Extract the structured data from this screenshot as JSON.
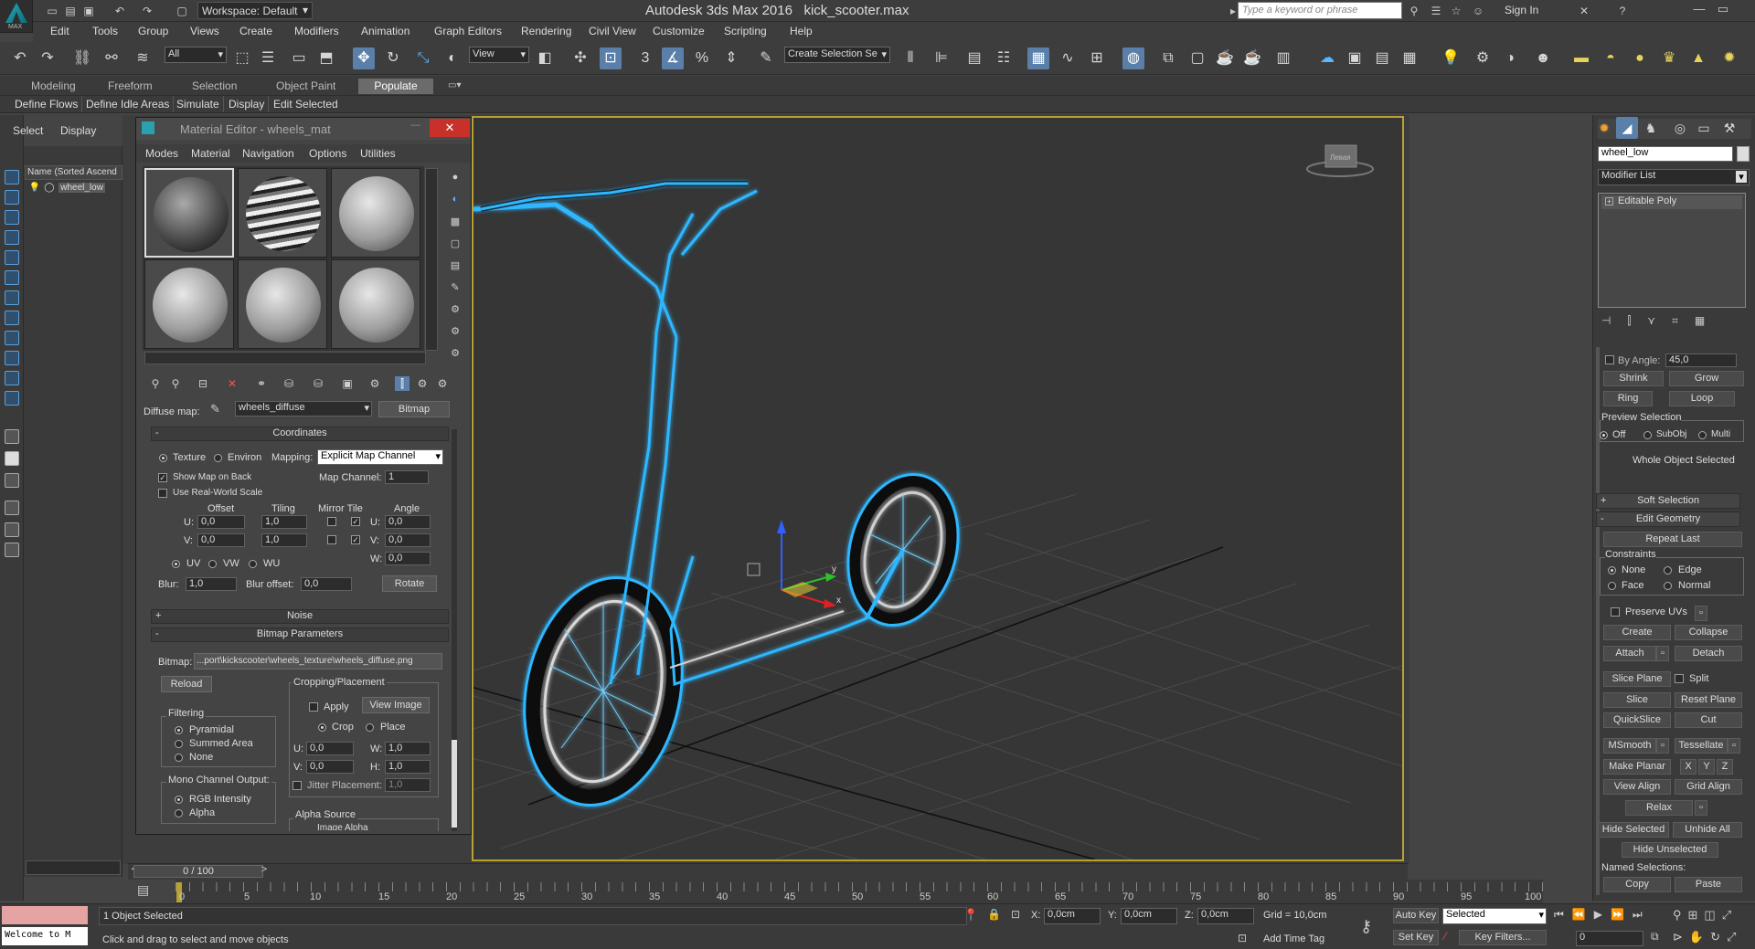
{
  "app": {
    "title": "Autodesk 3ds Max 2016",
    "file": "kick_scooter.max",
    "logo_text": "MAX",
    "workspace": "Workspace: Default",
    "search_placeholder": "Type a keyword or phrase",
    "sign_in": "Sign In"
  },
  "menu": [
    "Edit",
    "Tools",
    "Group",
    "Views",
    "Create",
    "Modifiers",
    "Animation",
    "Graph Editors",
    "Rendering",
    "Civil View",
    "Customize",
    "Scripting",
    "Help"
  ],
  "toolbar": {
    "selection_filter": "All",
    "ref_coord": "View",
    "named_selection": "Create Selection Se",
    "icons": [
      "undo-icon",
      "redo-icon",
      "link-icon",
      "unlink-icon",
      "bind-spacewarp-icon",
      "select-object-icon",
      "select-by-name-icon",
      "rect-region-icon",
      "window-crossing-icon",
      "select-move-icon",
      "select-rotate-icon",
      "select-scale-icon",
      "select-place-icon",
      "pivot-icon",
      "select-manipulate-icon",
      "snap-3-icon",
      "angle-snap-icon",
      "percent-snap-icon",
      "spinner-snap-icon",
      "edit-named-sel-icon",
      "mirror-icon",
      "align-icon",
      "layer-icon",
      "scene-explorer-icon",
      "graphite-icon",
      "curve-editor-icon",
      "schematic-icon",
      "material-editor-icon",
      "render-setup-icon",
      "rendered-frame-icon",
      "render-icon",
      "render-iterative-icon"
    ]
  },
  "ribbon": {
    "tabs": [
      "Modeling",
      "Freeform",
      "Selection",
      "Object Paint",
      "Populate"
    ],
    "active_tab": "Populate",
    "panels": [
      "Define Flows",
      "Define Idle Areas",
      "Simulate",
      "Display",
      "Edit Selected"
    ]
  },
  "scene_explorer": {
    "tabs": [
      "Select",
      "Display"
    ],
    "column": "Name (Sorted Ascend",
    "item": "wheel_low"
  },
  "material_editor": {
    "title": "Material Editor - wheels_mat",
    "menu": [
      "Modes",
      "Material",
      "Navigation",
      "Options",
      "Utilities"
    ],
    "diffuse_label": "Diffuse map:",
    "diffuse_map": "wheels_diffuse",
    "map_type": "Bitmap",
    "coordinates": {
      "header": "Coordinates",
      "texture": "Texture",
      "environ": "Environ",
      "mapping_label": "Mapping:",
      "mapping": "Explicit Map Channel",
      "show_map_on_back": "Show Map on Back",
      "map_channel_label": "Map Channel:",
      "map_channel": "1",
      "use_real_world": "Use Real-World Scale",
      "offset": "Offset",
      "tiling": "Tiling",
      "mirror_tile": "Mirror Tile",
      "angle": "Angle",
      "u_label": "U:",
      "v_label": "V:",
      "w_label": "W:",
      "u_offset": "0,0",
      "v_offset": "0,0",
      "u_tiling": "1,0",
      "v_tiling": "1,0",
      "u_angle": "0,0",
      "v_angle": "0,0",
      "w_angle": "0,0",
      "uv": "UV",
      "vw": "VW",
      "wu": "WU",
      "blur_label": "Blur:",
      "blur": "1,0",
      "blur_offset_label": "Blur offset:",
      "blur_offset": "0,0",
      "rotate": "Rotate"
    },
    "noise_header": "Noise",
    "bitmap": {
      "header": "Bitmap Parameters",
      "label": "Bitmap:",
      "path": "...port\\kickscooter\\wheels_texture\\wheels_diffuse.png",
      "reload": "Reload",
      "cropping": "Cropping/Placement",
      "apply": "Apply",
      "view_image": "View Image",
      "crop": "Crop",
      "place": "Place",
      "filtering": "Filtering",
      "pyramidal": "Pyramidal",
      "summed_area": "Summed Area",
      "none": "None",
      "u_label": "U:",
      "v_label": "V:",
      "w_label": "W:",
      "h_label": "H:",
      "u": "0,0",
      "v": "0,0",
      "w": "1,0",
      "h": "1,0",
      "jitter": "Jitter Placement:",
      "jitter_val": "1,0",
      "mono": "Mono Channel Output:",
      "rgb_intensity": "RGB Intensity",
      "alpha": "Alpha",
      "alpha_source": "Alpha Source",
      "image_alpha": "Image Alpha"
    }
  },
  "viewport": {
    "gizmo_x": "x",
    "gizmo_y": "y",
    "viewcube": "Левая"
  },
  "command_panel": {
    "object_name": "wheel_low",
    "modifier_list": "Modifier List",
    "stack_item": "Editable Poly",
    "by_angle_label": "By Angle:",
    "by_angle": "45,0",
    "shrink": "Shrink",
    "grow": "Grow",
    "ring": "Ring",
    "loop": "Loop",
    "preview_selection": "Preview Selection",
    "off": "Off",
    "subobj": "SubObj",
    "multi": "Multi",
    "whole_object": "Whole Object Selected",
    "soft_selection": "Soft Selection",
    "edit_geometry": "Edit Geometry",
    "repeat_last": "Repeat Last",
    "constraints": "Constraints",
    "none": "None",
    "edge": "Edge",
    "face": "Face",
    "normal": "Normal",
    "preserve_uvs": "Preserve UVs",
    "create": "Create",
    "collapse": "Collapse",
    "attach": "Attach",
    "detach": "Detach",
    "slice_plane": "Slice Plane",
    "split": "Split",
    "slice": "Slice",
    "reset_plane": "Reset Plane",
    "quickslice": "QuickSlice",
    "cut": "Cut",
    "msmooth": "MSmooth",
    "tessellate": "Tessellate",
    "make_planar": "Make Planar",
    "x": "X",
    "y": "Y",
    "z": "Z",
    "view_align": "View Align",
    "grid_align": "Grid Align",
    "relax": "Relax",
    "hide_selected": "Hide Selected",
    "unhide_all": "Unhide All",
    "hide_unselected": "Hide Unselected",
    "named_selections": "Named Selections:",
    "copy": "Copy",
    "paste": "Paste"
  },
  "timeline": {
    "slider": "0 / 100",
    "ticks": [
      "0",
      "5",
      "10",
      "15",
      "20",
      "25",
      "30",
      "35",
      "40",
      "45",
      "50",
      "55",
      "60",
      "65",
      "70",
      "75",
      "80",
      "85",
      "90",
      "95",
      "100"
    ]
  },
  "status": {
    "welcome": "Welcome to M",
    "selected": "1 Object Selected",
    "prompt": "Click and drag to select and move objects",
    "x_label": "X:",
    "x": "0,0cm",
    "y_label": "Y:",
    "y": "0,0cm",
    "z_label": "Z:",
    "z": "0,0cm",
    "grid": "Grid = 10,0cm",
    "add_time_tag": "Add Time Tag",
    "auto_key": "Auto Key",
    "auto_key_mode": "Selected",
    "set_key": "Set Key",
    "key_filters": "Key Filters...",
    "frame": "0"
  }
}
